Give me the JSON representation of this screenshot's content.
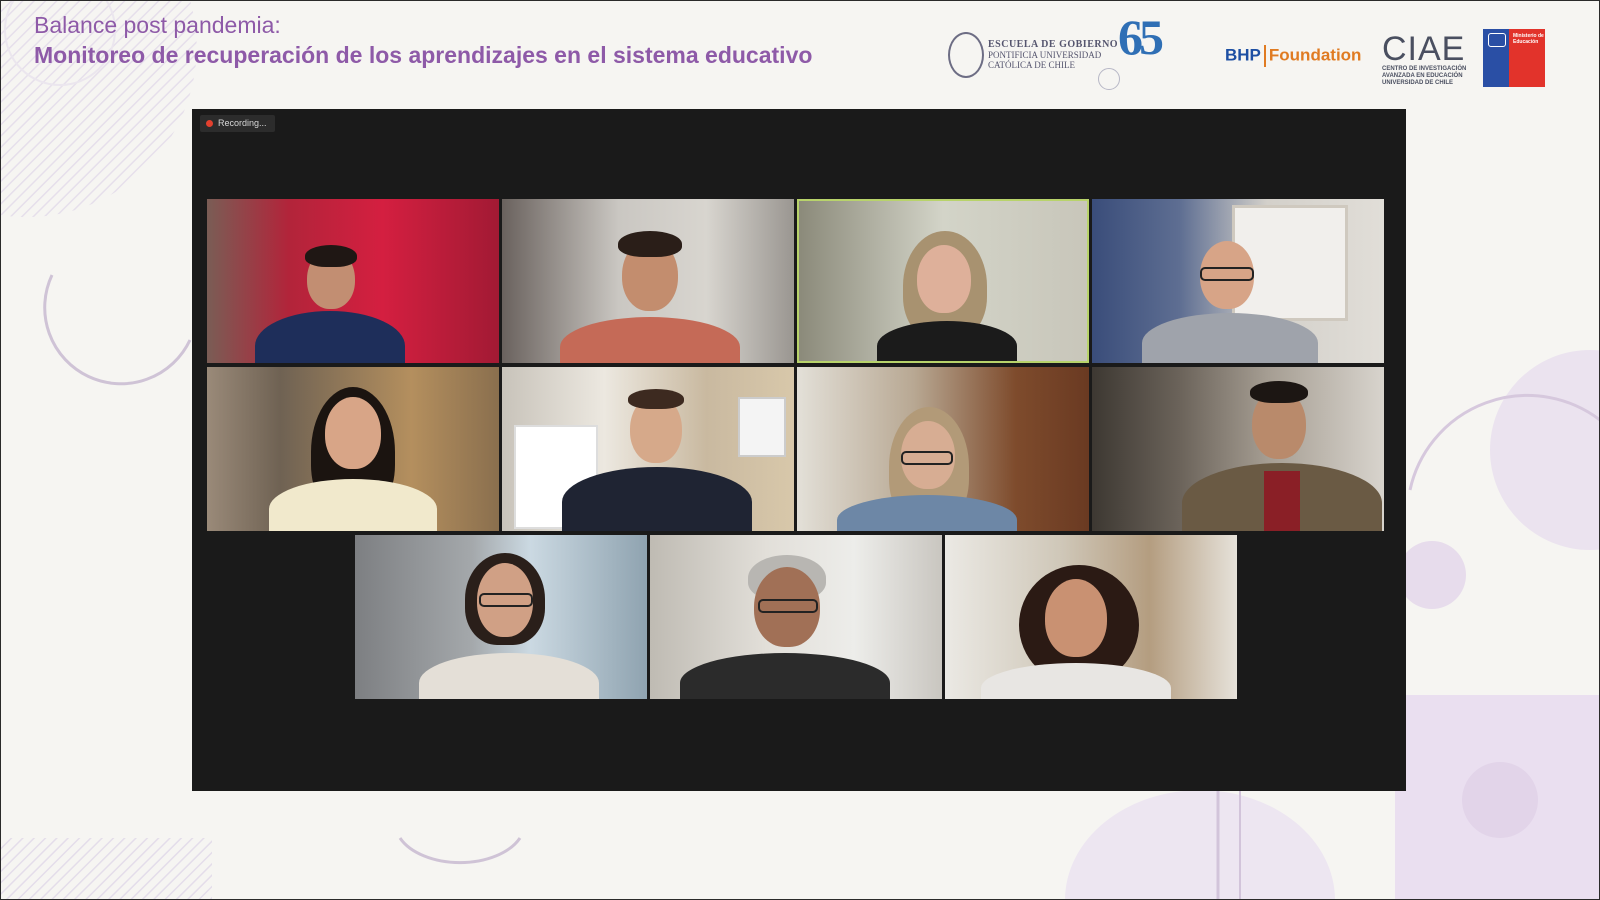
{
  "header": {
    "title_line1": "Balance post pandemia:",
    "title_line2": "Monitoreo de recuperación de los aprendizajes en el sistema educativo"
  },
  "logos": {
    "escuela_line1": "ESCUELA DE GOBIERNO",
    "escuela_line2": "PONTIFICIA UNIVERSIDAD",
    "escuela_line3": "CATÓLICA DE CHILE",
    "anniversary": "65",
    "bhp": "BHP",
    "foundation": "Foundation",
    "ciae": "CIAE",
    "ciae_line1": "CENTRO DE INVESTIGACIÓN",
    "ciae_line2": "AVANZADA EN EDUCACIÓN",
    "ciae_line3": "UNIVERSIDAD DE CHILE",
    "mineduc_line1": "Ministerio de",
    "mineduc_line2": "Educación"
  },
  "meeting": {
    "recording_label": "Recording...",
    "colors": {
      "active_border": "#b8d36b",
      "recording_dot": "#e3402e",
      "background": "#1a1a1a"
    }
  }
}
